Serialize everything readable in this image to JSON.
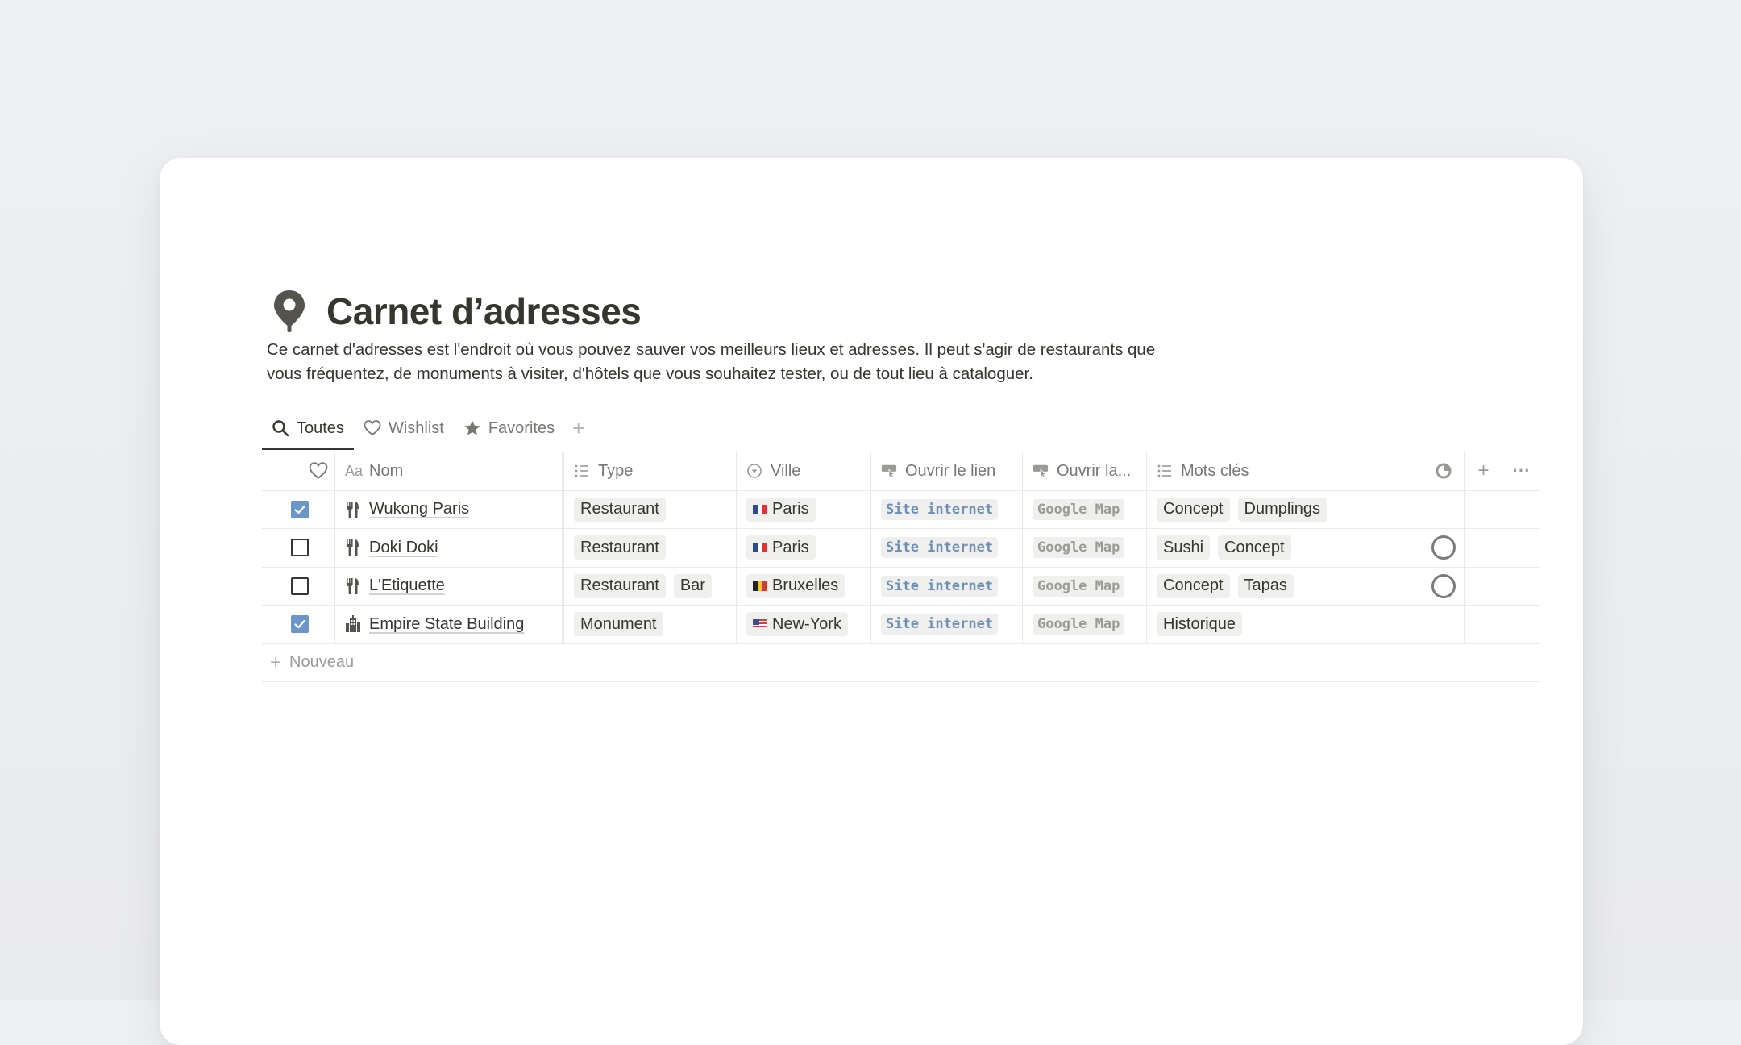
{
  "page": {
    "title": "Carnet d’adresses",
    "title_icon": "map-pin-icon",
    "description": "Ce carnet d'adresses est l'endroit où vous pouvez sauver vos meilleurs lieux et adresses. Il peut s'agir de restaurants que vous fréquentez, de monuments à visiter, d'hôtels que vous souhaitez tester, ou de tout lieu à cataloguer."
  },
  "tabs": [
    {
      "label": "Toutes",
      "icon": "search-icon",
      "active": true
    },
    {
      "label": "Wishlist",
      "icon": "heart-icon",
      "active": false
    },
    {
      "label": "Favorites",
      "icon": "star-icon",
      "active": false
    }
  ],
  "table": {
    "headers": {
      "name_prefix": "Aa",
      "name": "Nom",
      "type": "Type",
      "city": "Ville",
      "link": "Ouvrir le lien",
      "map": "Ouvrir la...",
      "tags": "Mots clés"
    },
    "rows": [
      {
        "fav": true,
        "icon": "fork-knife-icon",
        "name": "Wukong Paris",
        "types": [
          "Restaurant"
        ],
        "flag": "fr",
        "city": "Paris",
        "link": "Site internet",
        "map": "Google Map",
        "tags": [
          "Concept",
          "Dumplings"
        ],
        "progress": false
      },
      {
        "fav": false,
        "icon": "fork-knife-icon",
        "name": "Doki Doki",
        "types": [
          "Restaurant"
        ],
        "flag": "fr",
        "city": "Paris",
        "link": "Site internet",
        "map": "Google Map",
        "tags": [
          "Sushi",
          "Concept"
        ],
        "progress": true
      },
      {
        "fav": false,
        "icon": "fork-knife-icon",
        "name": "L'Etiquette",
        "types": [
          "Restaurant",
          "Bar"
        ],
        "flag": "be",
        "city": "Bruxelles",
        "link": "Site internet",
        "map": "Google Map",
        "tags": [
          "Concept",
          "Tapas"
        ],
        "progress": true
      },
      {
        "fav": true,
        "icon": "building-icon",
        "name": "Empire State Building",
        "types": [
          "Monument"
        ],
        "flag": "us",
        "city": "New-York",
        "link": "Site internet",
        "map": "Google Map",
        "tags": [
          "Historique"
        ],
        "progress": false
      }
    ],
    "new_label": "Nouveau"
  },
  "colors": {
    "checkbox_checked": "#6c95c9",
    "link_text": "#6d8fb5",
    "tag_bg": "#efefed"
  }
}
